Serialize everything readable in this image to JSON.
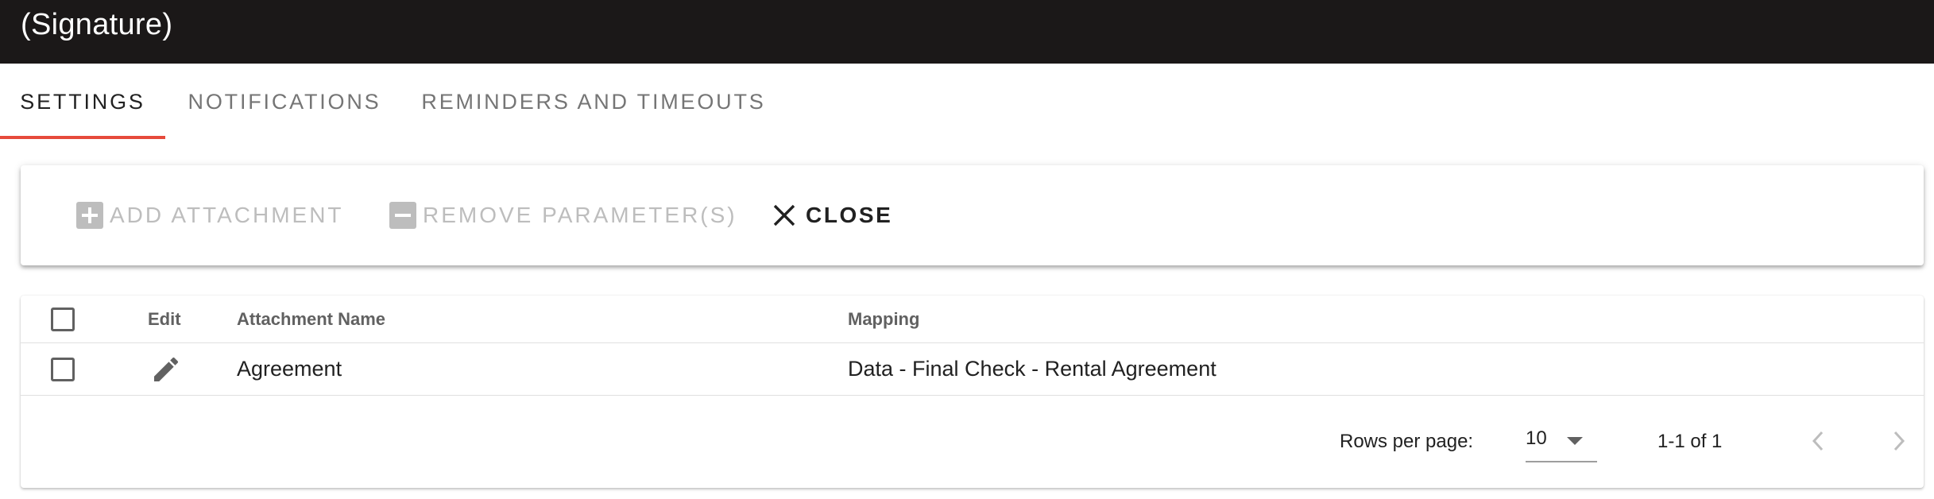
{
  "window": {
    "title": "(Signature)"
  },
  "tabs": [
    {
      "label": "SETTINGS",
      "active": true
    },
    {
      "label": "NOTIFICATIONS",
      "active": false
    },
    {
      "label": "REMINDERS AND TIMEOUTS",
      "active": false
    }
  ],
  "toolbar": {
    "add_attachment_label": "ADD ATTACHMENT",
    "remove_parameters_label": "REMOVE PARAMETER(S)",
    "close_label": "CLOSE"
  },
  "table": {
    "columns": {
      "edit": "Edit",
      "attachment_name": "Attachment Name",
      "mapping": "Mapping"
    },
    "rows": [
      {
        "attachment_name": "Agreement",
        "mapping": "Data - Final Check - Rental Agreement",
        "selected": false
      }
    ]
  },
  "pagination": {
    "rows_per_page_label": "Rows per page:",
    "rows_per_page_value": "10",
    "range_text": "1-1 of 1"
  },
  "colors": {
    "titlebar_bg": "#1b1818",
    "active_tab_indicator": "#e64a3b",
    "disabled_text": "#bdbdbd"
  }
}
